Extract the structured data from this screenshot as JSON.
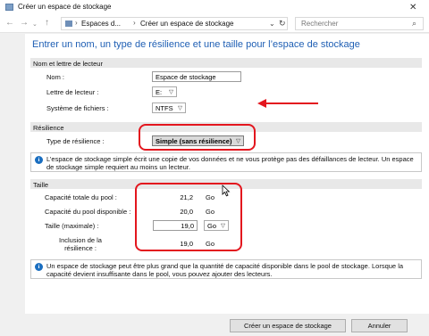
{
  "window": {
    "title": "Créer un espace de stockage",
    "close_glyph": "✕"
  },
  "nav": {
    "back": "←",
    "forward": "→",
    "up": "↑",
    "breadcrumb": [
      "Espaces d...",
      "Créer un espace de stockage"
    ],
    "search_placeholder": "Rechercher"
  },
  "heading": "Entrer un nom, un type de résilience et une taille pour l’espace de stockage",
  "drive": {
    "section": "Nom et lettre de lecteur",
    "name_label": "Nom :",
    "name_value": "Espace de stockage",
    "letter_label": "Lettre de lecteur :",
    "letter_value": "E:",
    "fs_label": "Système de fichiers :",
    "fs_value": "NTFS"
  },
  "resilience": {
    "section": "Résilience",
    "type_label": "Type de résilience :",
    "type_value": "Simple (sans résilience)",
    "info": "L’espace de stockage simple écrit une copie de vos données et ne vous protège pas des défaillances de lecteur. Un espace de stockage simple requiert au moins un lecteur."
  },
  "size": {
    "section": "Taille",
    "total_label": "Capacité totale du pool :",
    "total_value": "21,2",
    "total_unit": "Go",
    "available_label": "Capacité du pool disponible :",
    "available_value": "20,0",
    "available_unit": "Go",
    "max_label": "Taille (maximale) :",
    "max_value": "19,0",
    "max_unit": "Go",
    "inclusion_label": "Inclusion de la résilience :",
    "inclusion_value": "19,0",
    "inclusion_unit": "Go",
    "info": "Un espace de stockage peut être plus grand que la quantité de capacité disponible dans le pool de stockage. Lorsque la capacité devient insuffisante dans le pool, vous pouvez ajouter des lecteurs."
  },
  "buttons": {
    "create": "Créer un espace de stockage",
    "cancel": "Annuler"
  },
  "colors": {
    "accent": "#1f5fb4",
    "annotation": "#e3161e",
    "info_icon": "#1a6ec0"
  }
}
